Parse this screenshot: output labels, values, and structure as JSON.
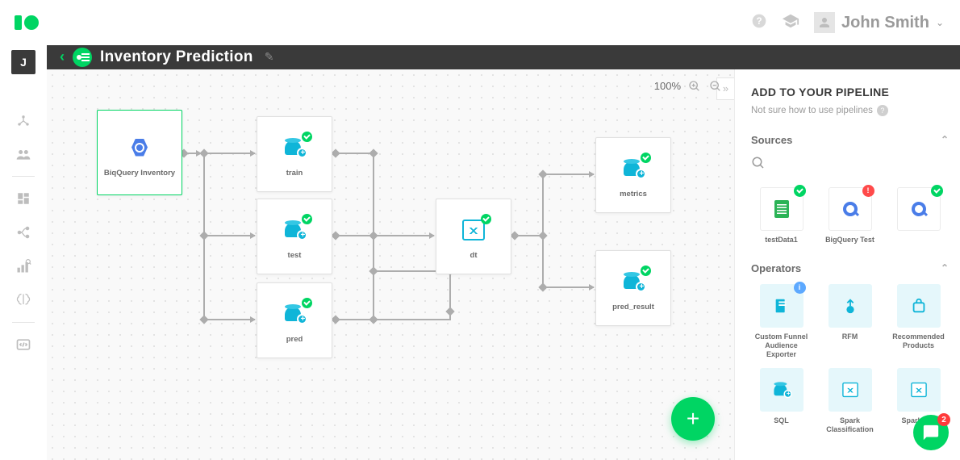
{
  "header": {
    "username": "John Smith"
  },
  "sidebar": {
    "project_initial": "J"
  },
  "title_bar": {
    "title": "Inventory Prediction"
  },
  "canvas": {
    "zoom": "100%",
    "nodes": {
      "bq": "BiqQuery Inventory",
      "train": "train",
      "test": "test",
      "pred": "pred",
      "dt": "dt",
      "metrics": "metrics",
      "pred_result": "pred_result"
    }
  },
  "panel": {
    "title": "ADD TO YOUR PIPELINE",
    "subtitle": "Not sure how to use pipelines",
    "sections": {
      "sources": "Sources",
      "operators": "Operators"
    },
    "sources": [
      {
        "label": "testData1",
        "badge": "ok"
      },
      {
        "label": "BigQuery Test",
        "badge": "warn"
      },
      {
        "label": "",
        "badge": "ok"
      }
    ],
    "operators": [
      {
        "label": "Custom Funnel Audience Exporter",
        "badge": "info",
        "badge_text": "i"
      },
      {
        "label": "RFM"
      },
      {
        "label": "Recommended Products"
      },
      {
        "label": "SQL"
      },
      {
        "label": "Spark Classification"
      },
      {
        "label": "Spark Clu"
      }
    ]
  },
  "chat": {
    "unread": "2"
  }
}
